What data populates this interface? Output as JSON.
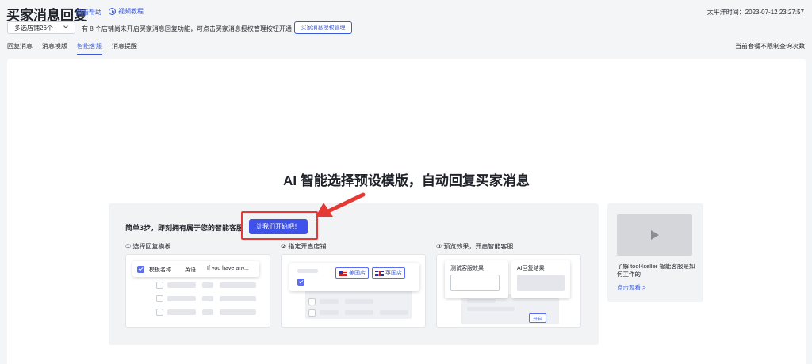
{
  "header": {
    "title": "买家消息回复",
    "help_link": "查看帮助",
    "video_link": "视频教程",
    "timezone": "太平洋时间：2023-07-12 23:27:57"
  },
  "filter": {
    "store_select": "多选店铺26个",
    "notice": "有 8 个店铺尚未开启买家消息回复功能，可点击买家消息授权管理按钮开通",
    "auth_button": "买家消息授权管理"
  },
  "tabs": [
    {
      "label": "回复消息",
      "active": false
    },
    {
      "label": "消息模版",
      "active": false
    },
    {
      "label": "智能客服",
      "active": true
    },
    {
      "label": "消息提醒",
      "active": false
    }
  ],
  "quota": "当前套餐不限制查询次数",
  "main": {
    "hero": "AI 智能选择预设模版，自动回复买家消息",
    "steps_title": "简单3步，即刻拥有属于您的智能客服",
    "start_button": "让我们开始吧！",
    "steps": [
      {
        "label": "① 选择回复模板"
      },
      {
        "label": "② 指定开启店铺"
      },
      {
        "label": "③ 预览效果，开启智能客服"
      }
    ],
    "step1": {
      "col1": "模板名称",
      "col2": "英语",
      "col3": "If you have any..."
    },
    "step2": {
      "store_us": "美国店",
      "store_uk": "英国店"
    },
    "step3": {
      "test_label": "测试客服效果",
      "result_label": "AI回复结果",
      "open_button": "开启"
    }
  },
  "video_card": {
    "description": "了解 tool4seller 智能客服是如何工作的",
    "watch_link": "点击观看 >"
  },
  "colors": {
    "accent": "#3b5bdb",
    "primary_button": "#3f51e8",
    "annotation": "#e53935"
  }
}
